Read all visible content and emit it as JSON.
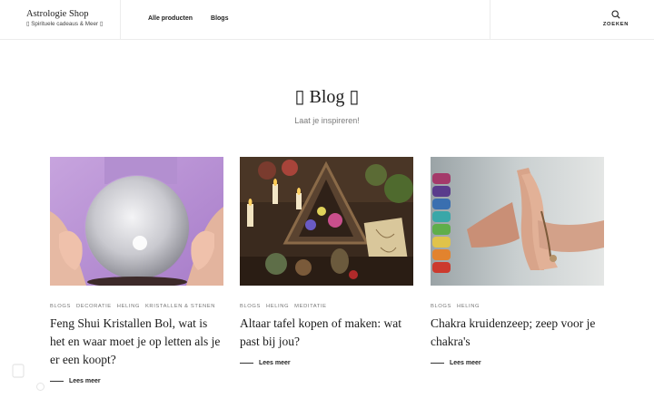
{
  "header": {
    "brand_title": "Astrologie Shop",
    "brand_tagline": "▯ Spirituele cadeaus & Meer ▯",
    "nav": [
      {
        "label": "Alle producten"
      },
      {
        "label": "Blogs"
      }
    ],
    "search_label": "ZOEKEN",
    "search_icon": "search-icon"
  },
  "hero": {
    "title": "▯ Blog ▯",
    "subtitle": "Laat je inspireren!"
  },
  "posts": [
    {
      "tags": [
        "BLOGS",
        "DECORATIE",
        "HELING",
        "KRISTALLEN & STENEN"
      ],
      "title": "Feng Shui Kristallen Bol, wat is het en waar moet je op letten als je er een koopt?",
      "read_more": "Lees meer"
    },
    {
      "tags": [
        "BLOGS",
        "HELING",
        "MEDITATIE"
      ],
      "title": "Altaar tafel kopen of maken: wat past bij jou?",
      "read_more": "Lees meer"
    },
    {
      "tags": [
        "BLOGS",
        "HELING"
      ],
      "title": "Chakra kruidenzeep; zeep voor je chakra's",
      "read_more": "Lees meer"
    }
  ],
  "colors": {
    "text": "#1b1b1b",
    "muted": "#7b7b7b",
    "border": "#ececec"
  }
}
